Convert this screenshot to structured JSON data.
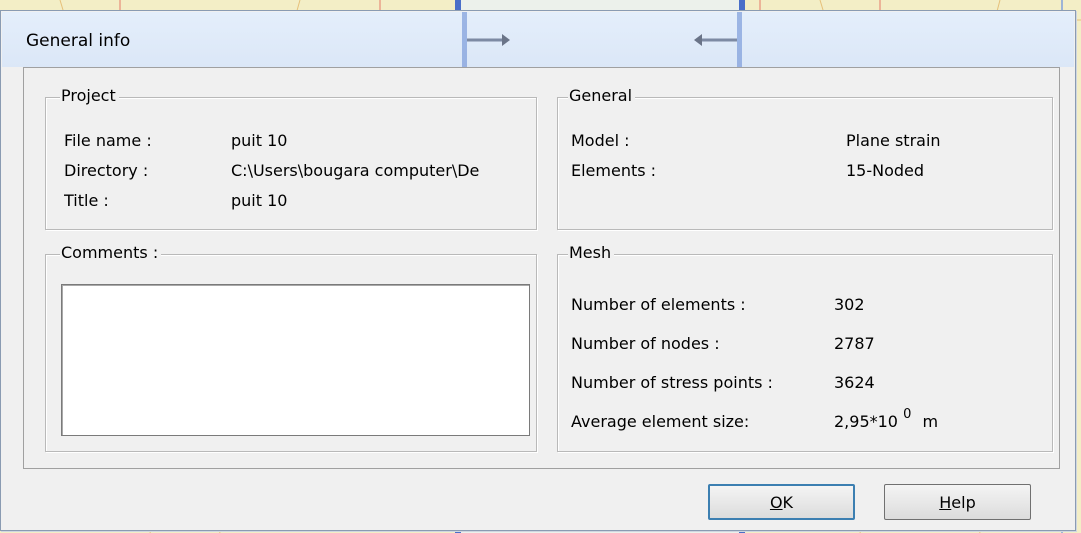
{
  "dialog": {
    "title": "General info"
  },
  "project": {
    "legend": "Project",
    "rows": [
      {
        "label": "File name :",
        "value": "puit 10"
      },
      {
        "label": "Directory :",
        "value": "C:\\Users\\bougara computer\\De"
      },
      {
        "label": "Title :",
        "value": "puit 10"
      }
    ]
  },
  "general": {
    "legend": "General",
    "rows": [
      {
        "label": "Model :",
        "value": "Plane strain"
      },
      {
        "label": "Elements :",
        "value": "15-Noded"
      }
    ]
  },
  "comments": {
    "legend": "Comments :",
    "value": ""
  },
  "mesh": {
    "legend": "Mesh",
    "rows": [
      {
        "label": "Number of elements :",
        "value": "302"
      },
      {
        "label": "Number of nodes :",
        "value": "2787"
      },
      {
        "label": "Number of stress points :",
        "value": "3624"
      }
    ],
    "avg_label": "Average element size:",
    "avg_mantissa": "2,95*10",
    "avg_exponent": "0",
    "avg_unit": "m"
  },
  "buttons": {
    "ok": {
      "accel": "O",
      "rest": "K"
    },
    "help": {
      "accel": "H",
      "rest": "elp"
    }
  },
  "colors": {
    "accent": "#3c7fb1",
    "background_canvas": "#f3eec6"
  }
}
